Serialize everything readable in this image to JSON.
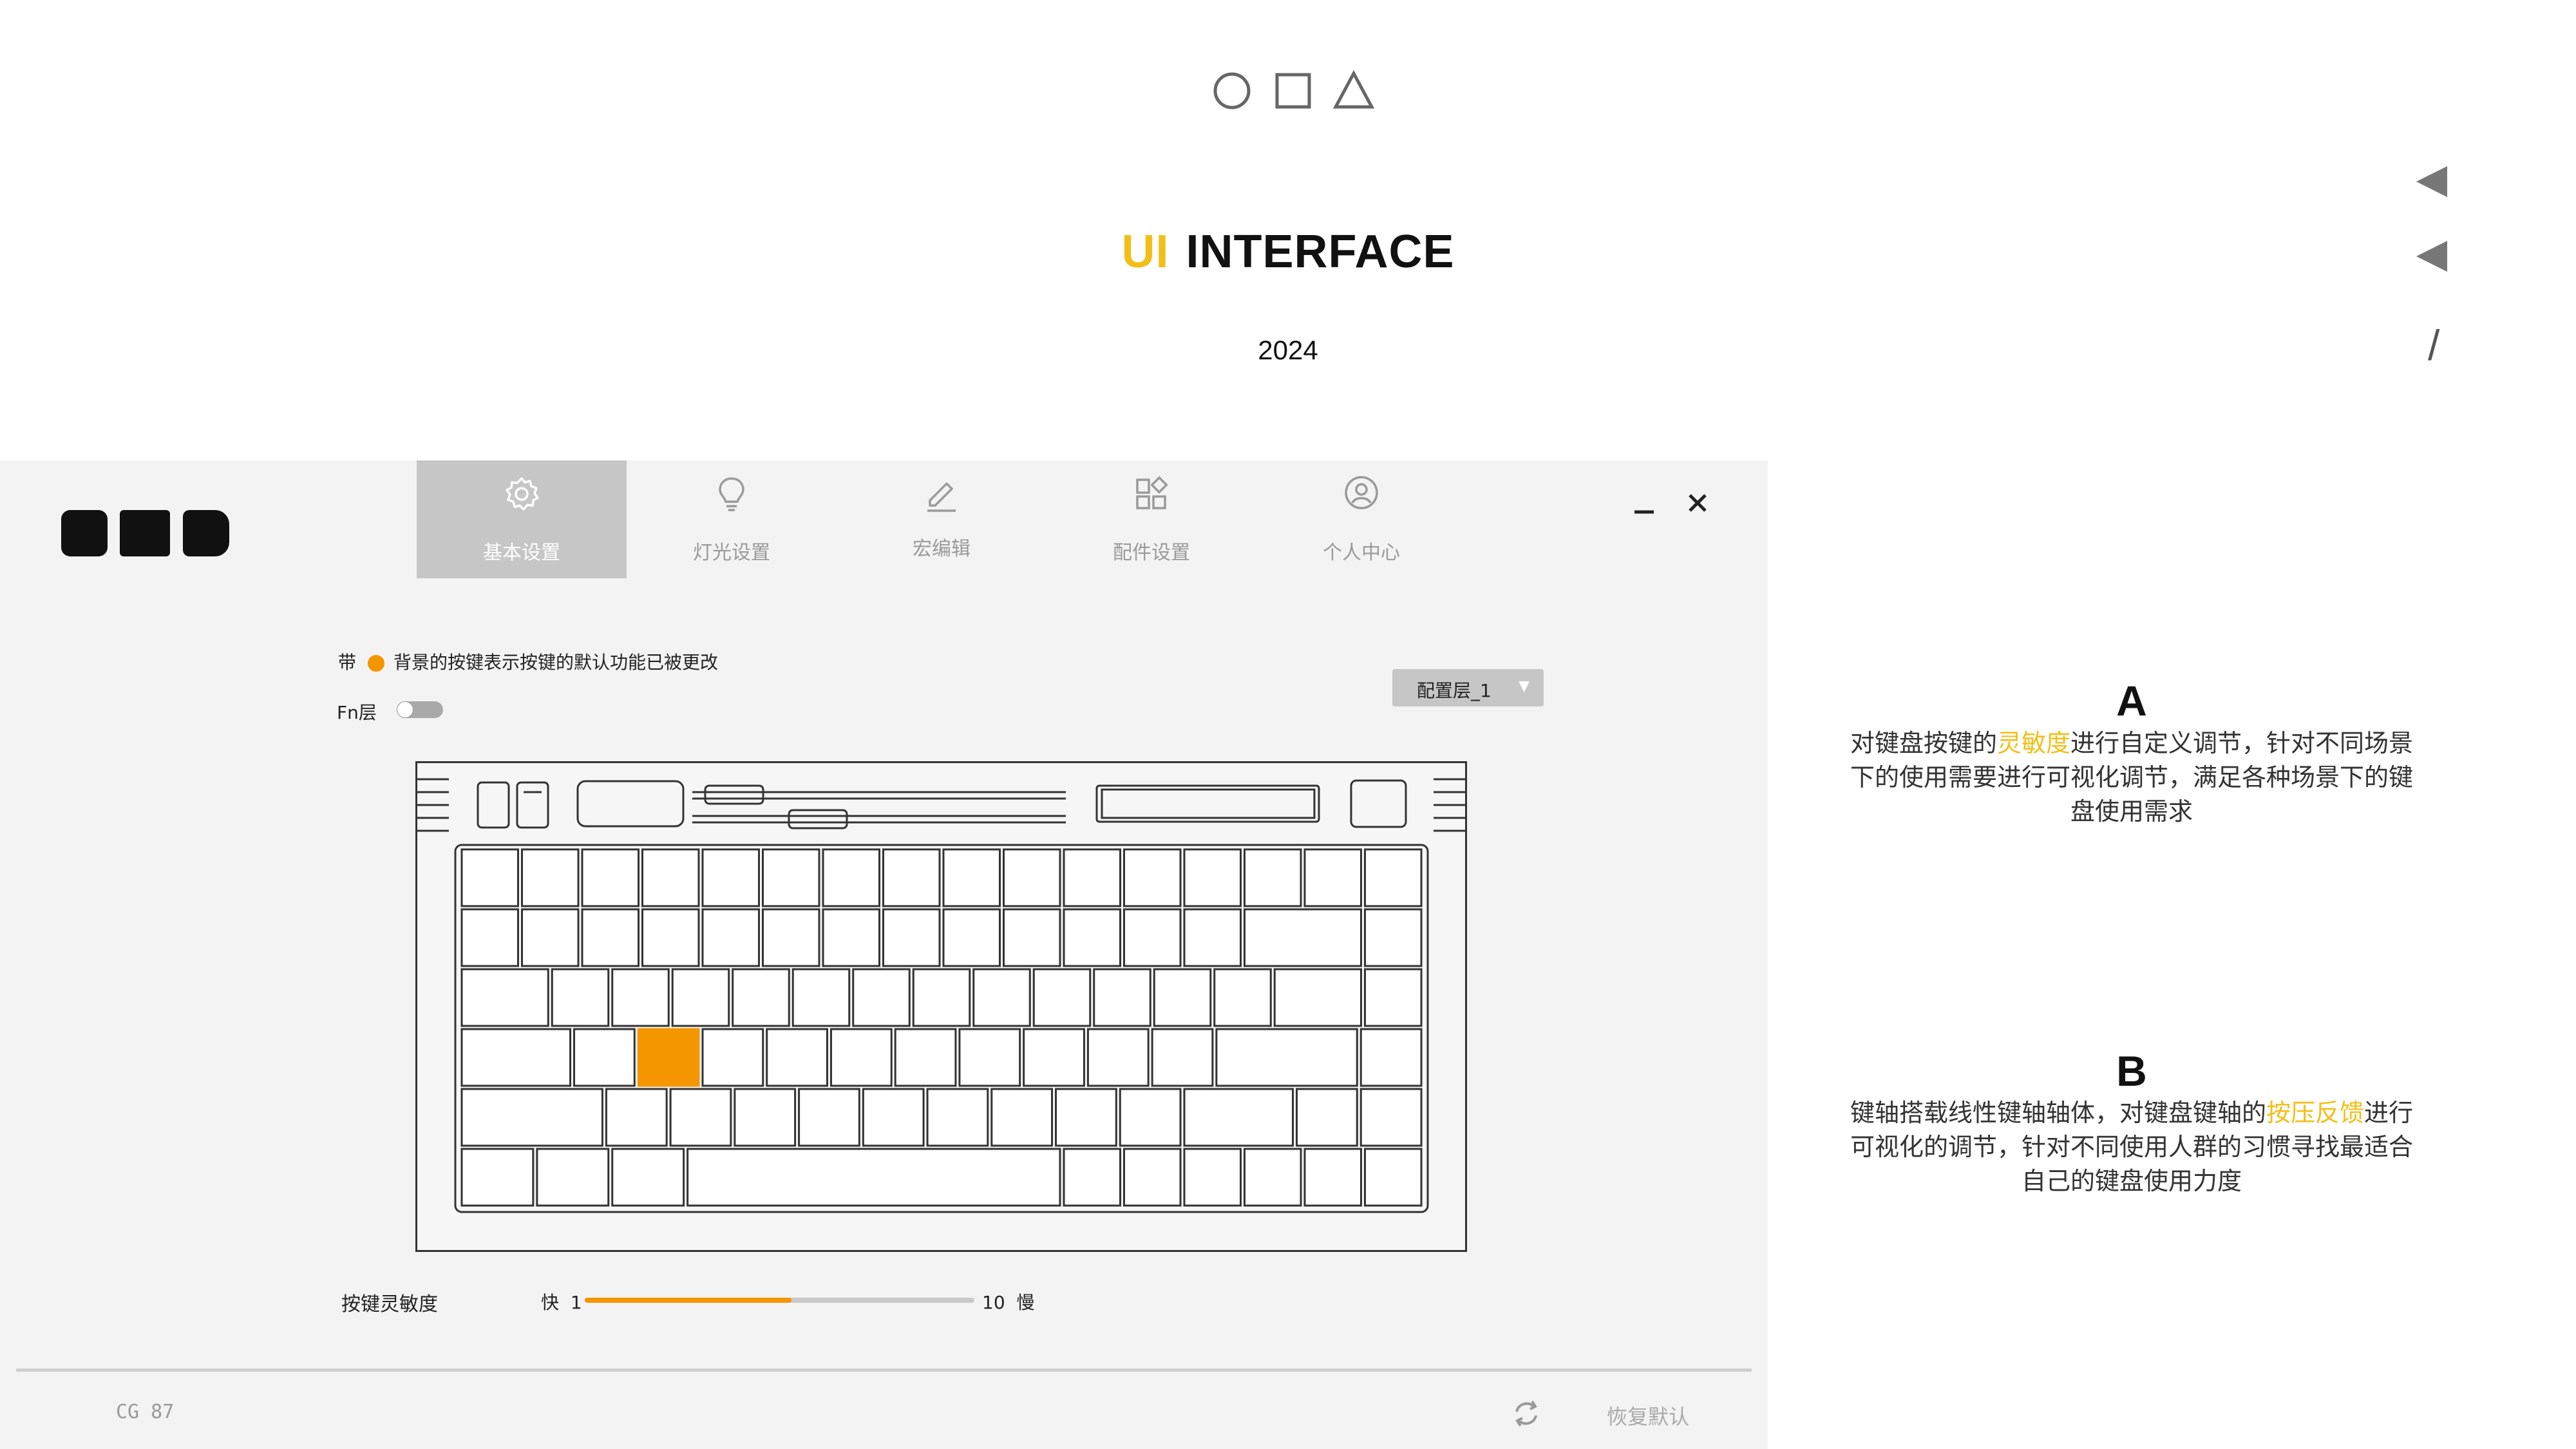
{
  "header": {
    "title_ui": "UI",
    "title_rest": "INTERFACE",
    "year": "2024",
    "slash": "/",
    "shape_icons": [
      "circle-icon",
      "square-icon",
      "triangle-icon"
    ],
    "accent_color": "#f2bf1a"
  },
  "app": {
    "tabs": [
      {
        "label": "基本设置",
        "icon": "gear-icon",
        "active": true
      },
      {
        "label": "灯光设置",
        "icon": "lightbulb-icon",
        "active": false
      },
      {
        "label": "宏编辑",
        "icon": "edit-icon",
        "active": false
      },
      {
        "label": "配件设置",
        "icon": "accessories-icon",
        "active": false
      },
      {
        "label": "个人中心",
        "icon": "user-icon",
        "active": false
      }
    ],
    "legend": {
      "prefix": "带",
      "text": "背景的按键表示按键的默认功能已被更改",
      "dot_color": "#f39600"
    },
    "fn_layer": {
      "label": "Fn层",
      "enabled": false
    },
    "profile_select": {
      "value": "配置层_1"
    },
    "keyboard": {
      "modified_key_row": 3,
      "modified_key_index": 2,
      "highlight_color": "#f39600"
    },
    "sensitivity": {
      "label": "按键灵敏度",
      "fast_label": "快",
      "min": "1",
      "max": "10",
      "slow_label": "慢",
      "value_fraction": 0.53
    },
    "footer": {
      "model": "CG 87",
      "reset_label": "恢复默认"
    }
  },
  "annotations": {
    "a": {
      "title": "A",
      "line1_pre": "对键盘按键的",
      "line1_hl": "灵敏度",
      "line1_post": "进行自定义调节，针对不同场景",
      "line2": "下的使用需要进行可视化调节，满足各种场景下的键",
      "line3": "盘使用需求"
    },
    "b": {
      "title": "B",
      "line1_pre": "键轴搭载线性键轴轴体，对键盘键轴的",
      "line1_hl": "按压反馈",
      "line1_post": "进行",
      "line2": "可视化的调节，针对不同使用人群的习惯寻找最适合",
      "line3": "自己的键盘使用力度"
    }
  }
}
